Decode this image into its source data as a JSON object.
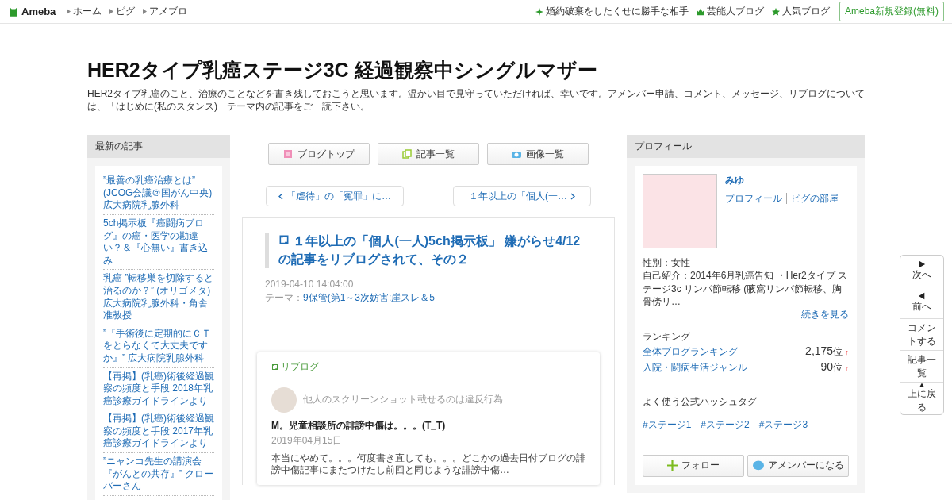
{
  "header": {
    "logo": "Ameba",
    "nav": [
      "ホーム",
      "ピグ",
      "アメブロ"
    ],
    "links": [
      {
        "kind": "sparkle",
        "label": "婚約破棄をしたくせに勝手な相手"
      },
      {
        "kind": "crown",
        "label": "芸能人ブログ"
      },
      {
        "kind": "star",
        "label": "人気ブログ"
      }
    ],
    "signup": "Ameba新規登録(無料)"
  },
  "blog": {
    "title": "HER2タイプ乳癌ステージ3C 経過観察中シングルマザー",
    "description": "HER2タイプ乳癌のこと、治療のことなどを書き残しておこうと思います。温かい目で見守っていただければ、幸いです。アメンバー申請、コメント、メッセージ、リブログについては、「はじめに(私のスタンス)」テーマ内の記事をご一読下さい。"
  },
  "recent": {
    "heading": "最新の記事",
    "items": [
      "”最善の乳癌治療とは” (JCOG会議＠国がん中央) 広大病院乳腺外科",
      "5ch掲示板『癌闘病ブログ』の癌・医学の勘違い？＆『心無い』書き込み",
      "乳癌 ”転移巣を切除すると治るのか？” (オリゴメタ) 広大病院乳腺外科・角舎准教授",
      "”『手術後に定期的にＣＴをとらなくて大丈夫ですか』” 広大病院乳腺外科",
      "【再掲】(乳癌)術後経過観察の頻度と手段 2018年乳癌診療ガイドラインより",
      "【再掲】(乳癌)術後経過観察の頻度と手段 2017年乳癌診療ガイドラインより",
      "”ニャンコ先生の講演会『がんとの共存』” クローバーさん"
    ]
  },
  "tools": [
    {
      "kind": "list",
      "label": "ブログトップ"
    },
    {
      "kind": "pages",
      "label": "記事一覧"
    },
    {
      "kind": "camera",
      "label": "画像一覧"
    }
  ],
  "pager": {
    "prev": "「虐待」の「冤罪」に…",
    "next": "１年以上の「個人(一…"
  },
  "article": {
    "title": "１年以上の「個人(一人)5ch掲示板」 嫌がらせ4/12の記事をリブログされて、その２",
    "date": "2019-04-10 14:04:00",
    "theme_label": "テーマ：",
    "theme": "9保管(第1～3次妨害:崖スレ＆5",
    "reblog": {
      "label": "リブログ",
      "author": "他人のスクリーンショット載せるのは違反行為",
      "title": "M。児童相談所の誹謗中傷は。。。(T_T)",
      "date": "2019年04月15日",
      "excerpt": "本当にやめて。。。何度書き直しても。。。どこかの過去日付ブログの誹謗中傷記事にまたつけたし前回と同じような誹謗中傷…"
    }
  },
  "profile": {
    "heading": "プロフィール",
    "name": "みゆ",
    "links": [
      "プロフィール",
      "ピグの部屋"
    ],
    "gender": "性別：女性",
    "intro": "自己紹介：2014年6月乳癌告知 ・Her2タイプ ステージ3c リンパ節転移 (腋窩リンパ節転移、胸骨傍リ…",
    "more": "続きを見る",
    "ranking_heading": "ランキング",
    "rankings": [
      {
        "label": "全体ブログランキング",
        "rank": "2,175",
        "unit": "位",
        "trend": "↑"
      },
      {
        "label": "入院・闘病生活ジャンル",
        "rank": "90",
        "unit": "位",
        "trend": "↑"
      }
    ],
    "hashtag_heading": "よく使う公式ハッシュタグ",
    "hashtags": [
      "#ステージ1",
      "#ステージ2",
      "#ステージ3"
    ],
    "buttons": [
      {
        "kind": "follow",
        "label": "フォロー"
      },
      {
        "kind": "amember",
        "label": "アメンバーになる"
      }
    ]
  },
  "sidenav": [
    {
      "kind": "next",
      "label": "次へ"
    },
    {
      "kind": "prev",
      "label": "前へ"
    },
    {
      "kind": "text",
      "label": "コメントする"
    },
    {
      "kind": "text",
      "label": "記事一覧"
    },
    {
      "kind": "top",
      "label": "上に戻る"
    }
  ]
}
